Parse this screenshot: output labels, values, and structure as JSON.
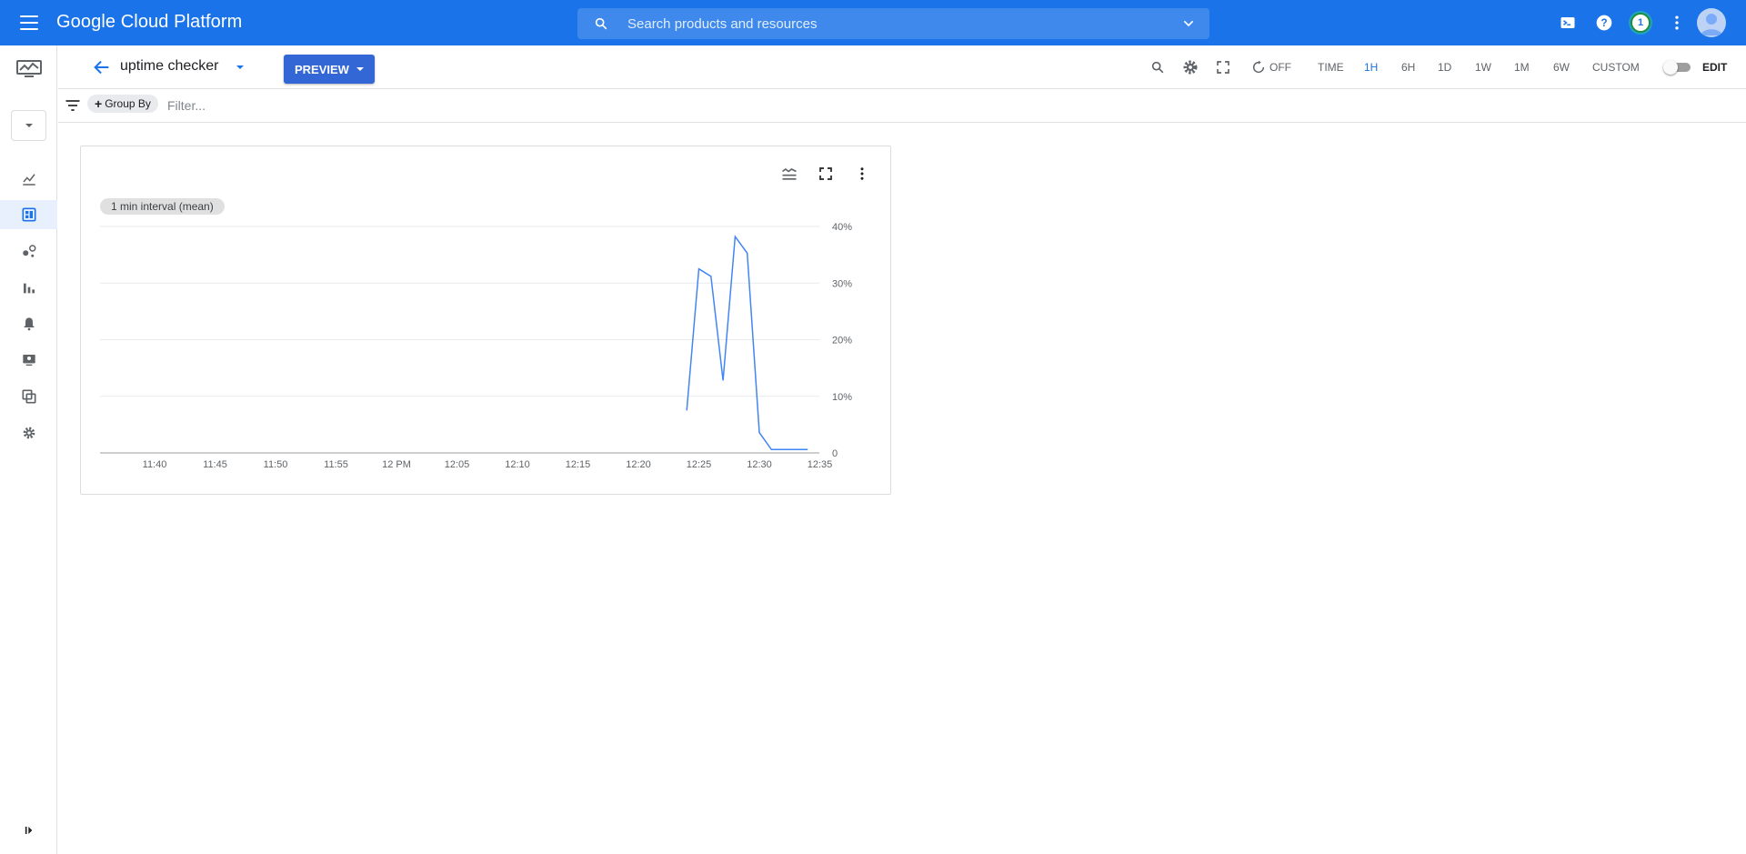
{
  "topbar": {
    "brand": "Google Cloud Platform",
    "search_placeholder": "Search products and resources",
    "notification_count": "1",
    "color": "#1a73e8"
  },
  "dashboard": {
    "title": "uptime checker",
    "preview_label": "PREVIEW",
    "auto_refresh": "OFF",
    "time_label": "TIME",
    "time_options": [
      "1H",
      "6H",
      "1D",
      "1W",
      "1M",
      "6W",
      "CUSTOM"
    ],
    "time_selected": "1H",
    "edit_label": "EDIT",
    "edit_enabled": false
  },
  "filterbar": {
    "group_by_label": "Group By",
    "filter_placeholder": "Filter..."
  },
  "widget": {
    "interval_label": "1 min interval (mean)"
  },
  "chart_data": {
    "type": "line",
    "x_tick_labels": [
      "11:40",
      "11:45",
      "11:50",
      "11:55",
      "12 PM",
      "12:05",
      "12:10",
      "12:15",
      "12:20",
      "12:25",
      "12:30",
      "12:35"
    ],
    "y_tick_labels": [
      "0",
      "10%",
      "20%",
      "30%",
      "40%"
    ],
    "ylim": [
      0,
      40
    ],
    "y_unit": "%",
    "grid": true,
    "series": [
      {
        "color": "#4285f4",
        "x": [
          "12:24",
          "12:25",
          "12:26",
          "12:27",
          "12:28",
          "12:29",
          "12:30",
          "12:31",
          "12:32",
          "12:33",
          "12:34"
        ],
        "values": [
          7.5,
          32.5,
          31.2,
          12.8,
          38.2,
          35.3,
          3.6,
          0.6,
          0.6,
          0.6,
          0.6
        ]
      }
    ]
  }
}
